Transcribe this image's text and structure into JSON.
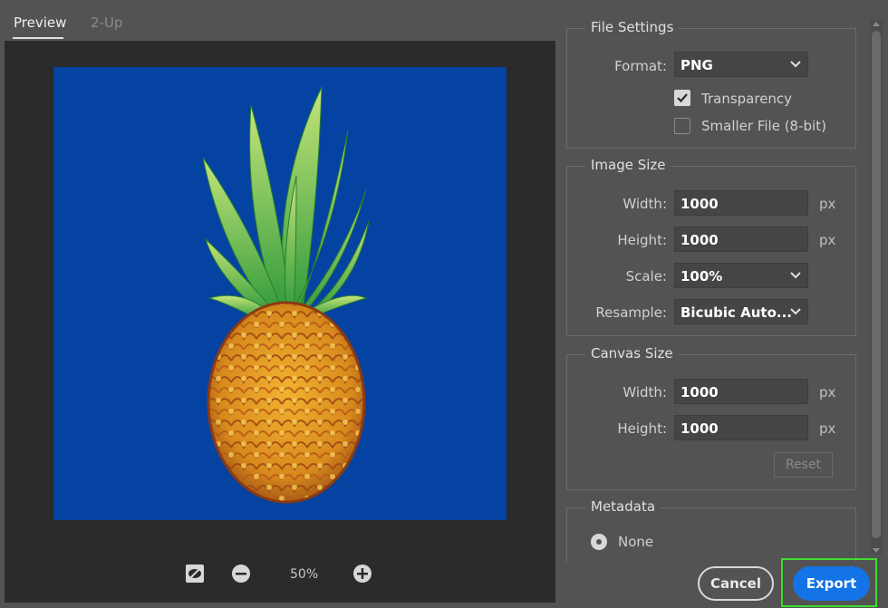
{
  "tabs": [
    {
      "label": "Preview",
      "active": true
    },
    {
      "label": "2-Up",
      "active": false
    }
  ],
  "preview": {
    "background_color": "#0543a2",
    "zoom_label": "50%"
  },
  "file_settings": {
    "title": "File Settings",
    "format_label": "Format:",
    "format_value": "PNG",
    "transparency_label": "Transparency",
    "transparency_checked": true,
    "smaller_file_label": "Smaller File (8-bit)",
    "smaller_file_checked": false
  },
  "image_size": {
    "title": "Image Size",
    "width_label": "Width:",
    "width_value": "1000",
    "width_unit": "px",
    "height_label": "Height:",
    "height_value": "1000",
    "height_unit": "px",
    "scale_label": "Scale:",
    "scale_value": "100%",
    "resample_label": "Resample:",
    "resample_value": "Bicubic Auto..."
  },
  "canvas_size": {
    "title": "Canvas Size",
    "width_label": "Width:",
    "width_value": "1000",
    "width_unit": "px",
    "height_label": "Height:",
    "height_value": "1000",
    "height_unit": "px",
    "reset_label": "Reset"
  },
  "metadata": {
    "title": "Metadata",
    "option_label": "None"
  },
  "footer": {
    "cancel_label": "Cancel",
    "export_label": "Export"
  },
  "colors": {
    "accent": "#1473e6",
    "highlight_outline": "#3ddc2f"
  }
}
